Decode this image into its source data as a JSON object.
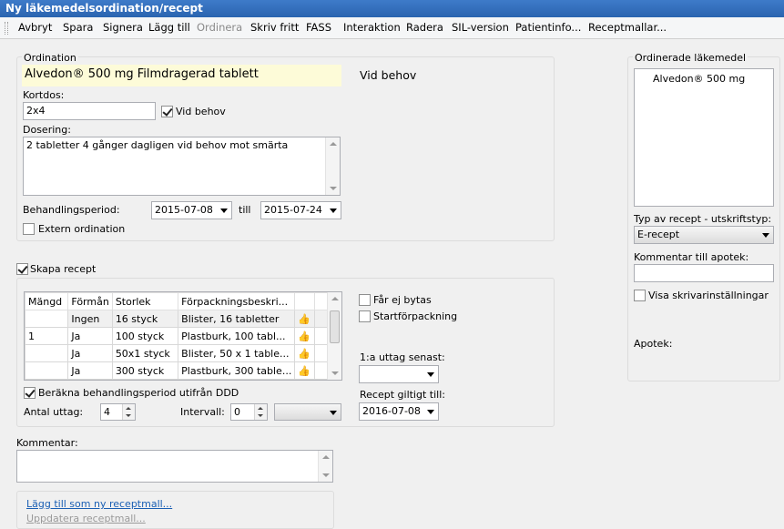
{
  "window": {
    "title": "Ny läkemedelsordination/recept"
  },
  "menu": {
    "items": [
      {
        "label": "Avbryt",
        "enabled": true
      },
      {
        "label": "Spara",
        "enabled": true
      },
      {
        "label": "Signera",
        "enabled": true
      },
      {
        "label": "Lägg till",
        "enabled": true
      },
      {
        "label": "Ordinera",
        "enabled": false
      },
      {
        "label": "Skriv fritt",
        "enabled": true
      },
      {
        "label": "FASS",
        "enabled": true
      },
      {
        "label": "Interaktion",
        "enabled": true
      },
      {
        "label": "Radera",
        "enabled": true
      },
      {
        "label": "SIL-version",
        "enabled": true
      },
      {
        "label": "Patientinfo...",
        "enabled": true
      },
      {
        "label": "Receptmallar...",
        "enabled": true
      }
    ]
  },
  "ordination": {
    "group_label": "Ordination",
    "drug_name": "Alvedon® 500 mg Filmdragerad tablett",
    "vid_behov_text": "Vid behov",
    "kortdos_label": "Kortdos:",
    "kortdos_value": "2x4",
    "vid_behov_checkbox_label": "Vid behov",
    "vid_behov_checked": true,
    "dosering_label": "Dosering:",
    "dosering_value": "2 tabletter 4 gånger dagligen vid behov mot smärta",
    "behandlingsperiod_label": "Behandlingsperiod:",
    "period_from": "2015-07-08",
    "till_label": "till",
    "period_to": "2015-07-24",
    "extern_label": "Extern ordination",
    "extern_checked": false
  },
  "recept": {
    "skapa_label": "Skapa recept",
    "skapa_checked": true,
    "table": {
      "headers": [
        "Mängd",
        "Förmån",
        "Storlek",
        "Förpackningsbeskri...",
        "",
        ""
      ],
      "rows": [
        {
          "mangd": "",
          "forman": "Ingen",
          "storlek": "16 styck",
          "beskr": "Blister, 16 tabletter"
        },
        {
          "mangd": "1",
          "forman": "Ja",
          "storlek": "100 styck",
          "beskr": "Plastburk, 100 tabl..."
        },
        {
          "mangd": "",
          "forman": "Ja",
          "storlek": "50x1 styck",
          "beskr": "Blister, 50 x 1 table..."
        },
        {
          "mangd": "",
          "forman": "Ja",
          "storlek": "300 styck",
          "beskr": "Plastburk, 300 table..."
        }
      ]
    },
    "far_ej_bytas_label": "Får ej bytas",
    "far_ej_bytas_checked": false,
    "startforpackning_label": "Startförpackning",
    "startforpackning_checked": false,
    "berakna_label": "Beräkna behandlingsperiod utifrån DDD",
    "berakna_checked": true,
    "antal_uttag_label": "Antal uttag:",
    "antal_uttag_value": "4",
    "intervall_label": "Intervall:",
    "intervall_value": "0",
    "intervall_unit": "",
    "forsta_uttag_label": "1:a uttag senast:",
    "forsta_uttag_value": "",
    "giltigt_label": "Recept giltigt till:",
    "giltigt_value": "2016-07-08"
  },
  "kommentar": {
    "label": "Kommentar:",
    "value": ""
  },
  "mall": {
    "add_link": "Lägg till som ny receptmall...",
    "update_link": "Uppdatera receptmall..."
  },
  "right": {
    "ordinerade_label": "Ordinerade läkemedel",
    "ordinerade_items": [
      "Alvedon® 500 mg"
    ],
    "typ_label": "Typ av recept - utskriftstyp:",
    "typ_value": "E-recept",
    "kommentar_apotek_label": "Kommentar till apotek:",
    "kommentar_apotek_value": "",
    "visa_skrivar_label": "Visa skrivarinställningar",
    "visa_skrivar_checked": false,
    "apotek_label": "Apotek:"
  },
  "colors": {
    "titlebar": "#2f6dbd",
    "drug_highlight": "#fdfbd8",
    "link": "#1a5fb4"
  },
  "icons": {
    "table_row_action": "thumbs-up-icon"
  }
}
